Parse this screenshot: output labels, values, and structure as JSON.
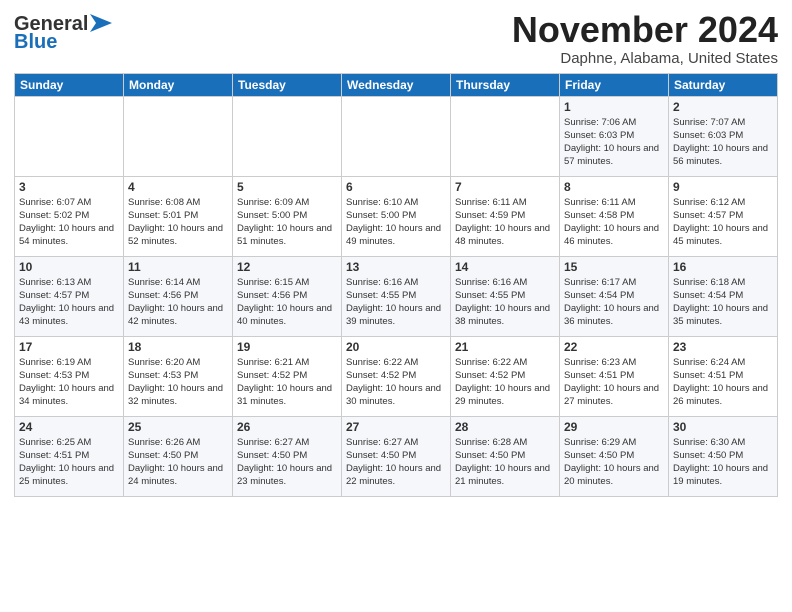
{
  "header": {
    "logo_general": "General",
    "logo_blue": "Blue",
    "month_title": "November 2024",
    "location": "Daphne, Alabama, United States"
  },
  "weekdays": [
    "Sunday",
    "Monday",
    "Tuesday",
    "Wednesday",
    "Thursday",
    "Friday",
    "Saturday"
  ],
  "weeks": [
    [
      {
        "day": "",
        "info": ""
      },
      {
        "day": "",
        "info": ""
      },
      {
        "day": "",
        "info": ""
      },
      {
        "day": "",
        "info": ""
      },
      {
        "day": "",
        "info": ""
      },
      {
        "day": "1",
        "info": "Sunrise: 7:06 AM\nSunset: 6:03 PM\nDaylight: 10 hours and 57 minutes."
      },
      {
        "day": "2",
        "info": "Sunrise: 7:07 AM\nSunset: 6:03 PM\nDaylight: 10 hours and 56 minutes."
      }
    ],
    [
      {
        "day": "3",
        "info": "Sunrise: 6:07 AM\nSunset: 5:02 PM\nDaylight: 10 hours and 54 minutes."
      },
      {
        "day": "4",
        "info": "Sunrise: 6:08 AM\nSunset: 5:01 PM\nDaylight: 10 hours and 52 minutes."
      },
      {
        "day": "5",
        "info": "Sunrise: 6:09 AM\nSunset: 5:00 PM\nDaylight: 10 hours and 51 minutes."
      },
      {
        "day": "6",
        "info": "Sunrise: 6:10 AM\nSunset: 5:00 PM\nDaylight: 10 hours and 49 minutes."
      },
      {
        "day": "7",
        "info": "Sunrise: 6:11 AM\nSunset: 4:59 PM\nDaylight: 10 hours and 48 minutes."
      },
      {
        "day": "8",
        "info": "Sunrise: 6:11 AM\nSunset: 4:58 PM\nDaylight: 10 hours and 46 minutes."
      },
      {
        "day": "9",
        "info": "Sunrise: 6:12 AM\nSunset: 4:57 PM\nDaylight: 10 hours and 45 minutes."
      }
    ],
    [
      {
        "day": "10",
        "info": "Sunrise: 6:13 AM\nSunset: 4:57 PM\nDaylight: 10 hours and 43 minutes."
      },
      {
        "day": "11",
        "info": "Sunrise: 6:14 AM\nSunset: 4:56 PM\nDaylight: 10 hours and 42 minutes."
      },
      {
        "day": "12",
        "info": "Sunrise: 6:15 AM\nSunset: 4:56 PM\nDaylight: 10 hours and 40 minutes."
      },
      {
        "day": "13",
        "info": "Sunrise: 6:16 AM\nSunset: 4:55 PM\nDaylight: 10 hours and 39 minutes."
      },
      {
        "day": "14",
        "info": "Sunrise: 6:16 AM\nSunset: 4:55 PM\nDaylight: 10 hours and 38 minutes."
      },
      {
        "day": "15",
        "info": "Sunrise: 6:17 AM\nSunset: 4:54 PM\nDaylight: 10 hours and 36 minutes."
      },
      {
        "day": "16",
        "info": "Sunrise: 6:18 AM\nSunset: 4:54 PM\nDaylight: 10 hours and 35 minutes."
      }
    ],
    [
      {
        "day": "17",
        "info": "Sunrise: 6:19 AM\nSunset: 4:53 PM\nDaylight: 10 hours and 34 minutes."
      },
      {
        "day": "18",
        "info": "Sunrise: 6:20 AM\nSunset: 4:53 PM\nDaylight: 10 hours and 32 minutes."
      },
      {
        "day": "19",
        "info": "Sunrise: 6:21 AM\nSunset: 4:52 PM\nDaylight: 10 hours and 31 minutes."
      },
      {
        "day": "20",
        "info": "Sunrise: 6:22 AM\nSunset: 4:52 PM\nDaylight: 10 hours and 30 minutes."
      },
      {
        "day": "21",
        "info": "Sunrise: 6:22 AM\nSunset: 4:52 PM\nDaylight: 10 hours and 29 minutes."
      },
      {
        "day": "22",
        "info": "Sunrise: 6:23 AM\nSunset: 4:51 PM\nDaylight: 10 hours and 27 minutes."
      },
      {
        "day": "23",
        "info": "Sunrise: 6:24 AM\nSunset: 4:51 PM\nDaylight: 10 hours and 26 minutes."
      }
    ],
    [
      {
        "day": "24",
        "info": "Sunrise: 6:25 AM\nSunset: 4:51 PM\nDaylight: 10 hours and 25 minutes."
      },
      {
        "day": "25",
        "info": "Sunrise: 6:26 AM\nSunset: 4:50 PM\nDaylight: 10 hours and 24 minutes."
      },
      {
        "day": "26",
        "info": "Sunrise: 6:27 AM\nSunset: 4:50 PM\nDaylight: 10 hours and 23 minutes."
      },
      {
        "day": "27",
        "info": "Sunrise: 6:27 AM\nSunset: 4:50 PM\nDaylight: 10 hours and 22 minutes."
      },
      {
        "day": "28",
        "info": "Sunrise: 6:28 AM\nSunset: 4:50 PM\nDaylight: 10 hours and 21 minutes."
      },
      {
        "day": "29",
        "info": "Sunrise: 6:29 AM\nSunset: 4:50 PM\nDaylight: 10 hours and 20 minutes."
      },
      {
        "day": "30",
        "info": "Sunrise: 6:30 AM\nSunset: 4:50 PM\nDaylight: 10 hours and 19 minutes."
      }
    ]
  ]
}
